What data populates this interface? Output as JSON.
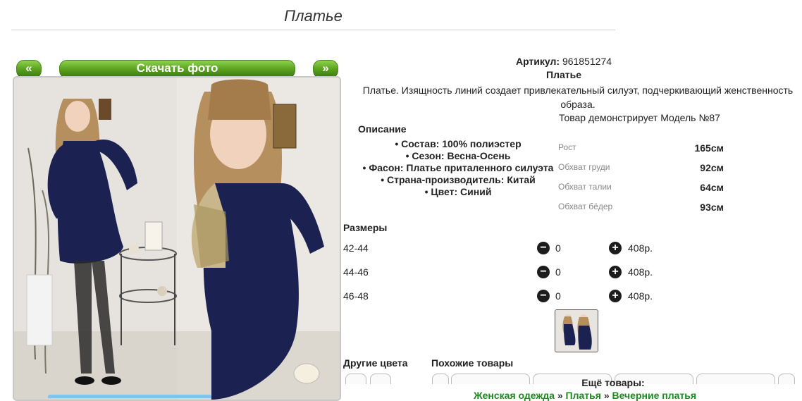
{
  "page": {
    "title": "Платье"
  },
  "gallery": {
    "prev_label": "«",
    "download_label": "Скачать фото",
    "next_label": "»"
  },
  "product": {
    "sku_label": "Артикул:",
    "sku_value": "961851274",
    "name": "Платье",
    "description": "Платье. Изящность линий создает привлекательный силуэт, подчеркивающий женственность образа.",
    "model_line": "Товар демонстрирует Модель №87"
  },
  "specs": {
    "heading": "Описание",
    "items": [
      "Состав: 100% полиэстер",
      "Сезон: Весна-Осень",
      "Фасон: Платье приталенного силуэта",
      "Страна-производитель: Китай",
      "Цвет: Синий"
    ]
  },
  "measurements": [
    {
      "label": "Рост",
      "value": "165см"
    },
    {
      "label": "Обхват груди",
      "value": "92см"
    },
    {
      "label": "Обхват талии",
      "value": "64см"
    },
    {
      "label": "Обхват бёдер",
      "value": "93см"
    }
  ],
  "sizes": {
    "heading": "Размеры",
    "rows": [
      {
        "size": "42-44",
        "qty": "0",
        "price": "408р."
      },
      {
        "size": "44-46",
        "qty": "0",
        "price": "408р."
      },
      {
        "size": "46-48",
        "qty": "0",
        "price": "408р."
      }
    ],
    "minus_icon": "minus-circle-icon",
    "plus_icon": "plus-circle-icon"
  },
  "footer": {
    "other_colors": "Другие цвета",
    "similar": "Похожие товары",
    "more": "Ещё товары:",
    "crumbs": [
      "Женская одежда",
      "Платья",
      "Вечерние платья"
    ],
    "crumb_sep": "»"
  },
  "colors": {
    "accent_green": "#5aa21f",
    "link_green": "#1c8a1c",
    "dress_navy": "#1b2150"
  }
}
